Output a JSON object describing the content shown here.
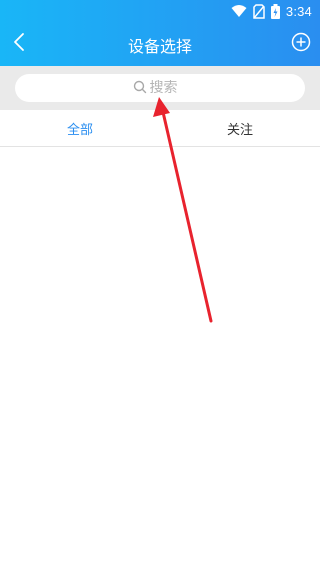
{
  "status_bar": {
    "time": "3:34",
    "icons": [
      "wifi-icon",
      "no-sim-icon",
      "battery-charging-icon"
    ]
  },
  "app_bar": {
    "title": "设备选择",
    "back_icon": "chevron-left-icon",
    "add_icon": "plus-circle-icon"
  },
  "search": {
    "placeholder": "搜索",
    "value": "",
    "icon": "search-icon"
  },
  "tabs": [
    {
      "label": "全部",
      "active": true
    },
    {
      "label": "关注",
      "active": false
    }
  ],
  "colors": {
    "header_start": "#19b6f7",
    "header_end": "#2a8ef0",
    "active_tab": "#2a8ef0",
    "annotation_arrow": "#e8232e"
  }
}
